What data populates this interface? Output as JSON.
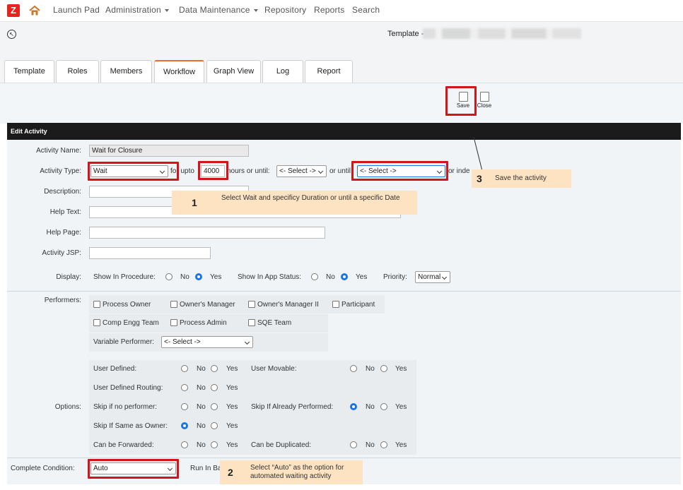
{
  "nav": {
    "logo": "Z",
    "items": [
      "Launch Pad",
      "Administration",
      "Data Maintenance",
      "Repository",
      "Reports",
      "Search"
    ]
  },
  "header": {
    "template_label": "Template -",
    "tabs": [
      "Template",
      "Roles",
      "Members",
      "Workflow",
      "Graph View",
      "Log",
      "Report"
    ],
    "active_tab": "Workflow"
  },
  "toolbar": {
    "save_label": "Save",
    "close_label": "Close"
  },
  "section_title": "Edit Activity",
  "form": {
    "activity_name_label": "Activity Name:",
    "activity_name_value": "Wait for Closure",
    "activity_type_label": "Activity Type:",
    "activity_type_value": "Wait",
    "for_upto_text": "for upto",
    "hours_value": "4000",
    "hours_or_until_text": "hours or until:",
    "select_placeholder": "<- Select ->",
    "or_until_text": "or until:",
    "or_indef_text": "or inde",
    "description_label": "Description:",
    "help_text_label": "Help Text:",
    "help_page_label": "Help Page:",
    "activity_jsp_label": "Activity JSP:",
    "display_label": "Display:",
    "show_in_procedure": "Show In Procedure:",
    "show_in_app_status": "Show In App Status:",
    "no": "No",
    "yes": "Yes",
    "priority_label": "Priority:",
    "priority_value": "Normal",
    "performers_label": "Performers:",
    "performers": [
      "Process Owner",
      "Owner's Manager",
      "Owner's Manager II",
      "Participant",
      "Comp Engg Team",
      "Process Admin",
      "SQE Team"
    ],
    "variable_performer_label": "Variable Performer:",
    "options_label": "Options:",
    "options_left": [
      "User Defined:",
      "User Defined Routing:",
      "Skip if no performer:",
      "Skip If Same as Owner:",
      "Can be Forwarded:"
    ],
    "options_right": [
      "User Movable:",
      "Skip If Already Performed:",
      "Can be Duplicated:"
    ],
    "complete_condition_label": "Complete Condition:",
    "complete_condition_value": "Auto",
    "run_in_bg_text": "Run In Ba"
  },
  "callouts": [
    {
      "num": "1",
      "text": "Select Wait and specificy Duration or until a specific Date"
    },
    {
      "num": "2",
      "text": "Select “Auto” as the option for automated waiting activity"
    },
    {
      "num": "3",
      "text": "Save the activity"
    }
  ],
  "colors": {
    "highlight": "#d4141b",
    "callout_bg": "#fde3c2",
    "header_bar": "#1b1b1b",
    "active_tab_accent": "#f06a2a",
    "radio_on": "#1a73e8",
    "logo": "#e8231f"
  }
}
